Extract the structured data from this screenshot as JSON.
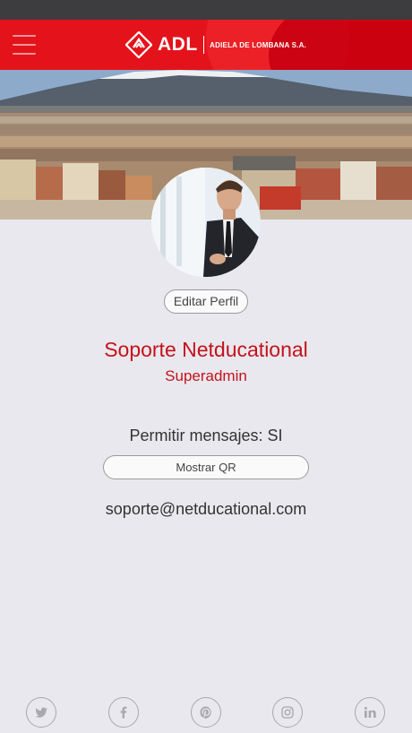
{
  "header": {
    "logo_text": "ADL",
    "logo_subtitle": "ADIELA DE LOMBANA S.A."
  },
  "profile": {
    "edit_label": "Editar Perfil",
    "name": "Soporte Netducational",
    "role": "Superadmin",
    "messages_label": "Permitir mensajes: SI",
    "qr_label": "Mostrar QR",
    "email": "soporte@netducational.com"
  },
  "colors": {
    "brand_red": "#e4131b",
    "accent_text": "#c4121b",
    "background": "#e9e8ee"
  },
  "social": [
    "twitter-icon",
    "facebook-icon",
    "pinterest-icon",
    "instagram-icon",
    "linkedin-icon"
  ]
}
